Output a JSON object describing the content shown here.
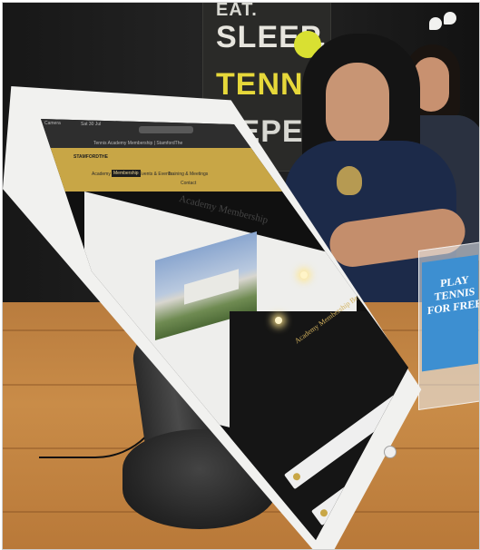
{
  "scene": {
    "poster": {
      "lines": [
        "EAT.",
        "SLEEP.",
        "TENNIS.",
        "REPEAT."
      ]
    },
    "sign": {
      "lines": [
        "PLAY",
        "TENNIS",
        "FOR FREE"
      ],
      "color": "#3d8fd1"
    },
    "tablet": {
      "browser": {
        "status_left": "Camera",
        "status_time": "Sat 30 Jul",
        "tab_title": "Tennis Academy Membership | StamfordThe"
      },
      "site": {
        "brand": "STAMFORDTHE",
        "brand_color": "#c8a646",
        "nav": [
          "Academy",
          "Membership",
          "Events & Events",
          "Training & Meetings",
          "Contact"
        ],
        "active_nav": "Membership",
        "page_heading": "Academy Membership",
        "benefits_heading": "Academy Membership Benefits"
      }
    }
  }
}
